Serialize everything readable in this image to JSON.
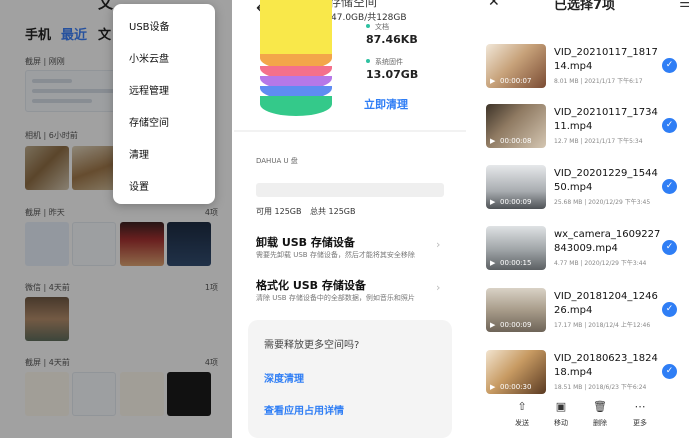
{
  "panel1": {
    "title_partial": "文",
    "tabs": [
      "手机",
      "最近",
      "文"
    ],
    "sections": [
      {
        "label": "截屏 | 刚刚",
        "count": ""
      },
      {
        "label": "相机 | 6小时前",
        "count": ""
      },
      {
        "label": "截屏 | 昨天",
        "count": "4项"
      },
      {
        "label": "微信 | 4天前",
        "count": "1项"
      },
      {
        "label": "截屏 | 4天前",
        "count": "4项"
      }
    ],
    "menu": [
      "USB设备",
      "小米云盘",
      "远程管理",
      "存储空间",
      "清理",
      "设置"
    ]
  },
  "panel2": {
    "title_partial": "存储空间",
    "used_text": "已使用47.0GB/共128GB",
    "legend": [
      {
        "label": "文档",
        "value": "87.46KB",
        "color": "#2fc1a1"
      },
      {
        "label": "系统固件",
        "value": "13.07GB",
        "color": "#2fc1a1"
      }
    ],
    "clean_now": "立即清理",
    "device_label": "DAHUA U 盘",
    "available": "可用 125GB",
    "total": "总共 125GB",
    "options": [
      {
        "title": "卸载 USB 存储设备",
        "desc": "需要先卸载 USB 存储设备，然后才能将其安全移除"
      },
      {
        "title": "格式化 USB 存储设备",
        "desc": "清除 USB 存储设备中的全部数据，例如音乐和照片"
      }
    ],
    "card": {
      "question": "需要释放更多空间吗?",
      "deep_clean": "深度清理",
      "app_usage": "查看应用占用详情"
    }
  },
  "panel3": {
    "title": "已选择7项",
    "videos": [
      {
        "name": "VID_20210117_181714.mp4",
        "meta": "8.01 MB | 2021/1/17 下午6:17",
        "duration": "00:00:07"
      },
      {
        "name": "VID_20210117_173411.mp4",
        "meta": "12.7 MB | 2021/1/17 下午5:34",
        "duration": "00:00:08"
      },
      {
        "name": "VID_20201229_154450.mp4",
        "meta": "25.68 MB | 2020/12/29 下午3:45",
        "duration": "00:00:09"
      },
      {
        "name": "wx_camera_1609227843009.mp4",
        "meta": "4.77 MB | 2020/12/29 下午3:44",
        "duration": "00:00:15"
      },
      {
        "name": "VID_20181204_124626.mp4",
        "meta": "17.17 MB | 2018/12/4 上午12:46",
        "duration": "00:00:09"
      },
      {
        "name": "VID_20180623_182418.mp4",
        "meta": "18.51 MB | 2018/6/23 下午6:24",
        "duration": "00:00:30"
      }
    ],
    "toolbar": [
      {
        "label": "发送",
        "icon": "share-icon"
      },
      {
        "label": "移动",
        "icon": "move-icon"
      },
      {
        "label": "删除",
        "icon": "trash-icon"
      },
      {
        "label": "更多",
        "icon": "more-icon"
      }
    ]
  }
}
